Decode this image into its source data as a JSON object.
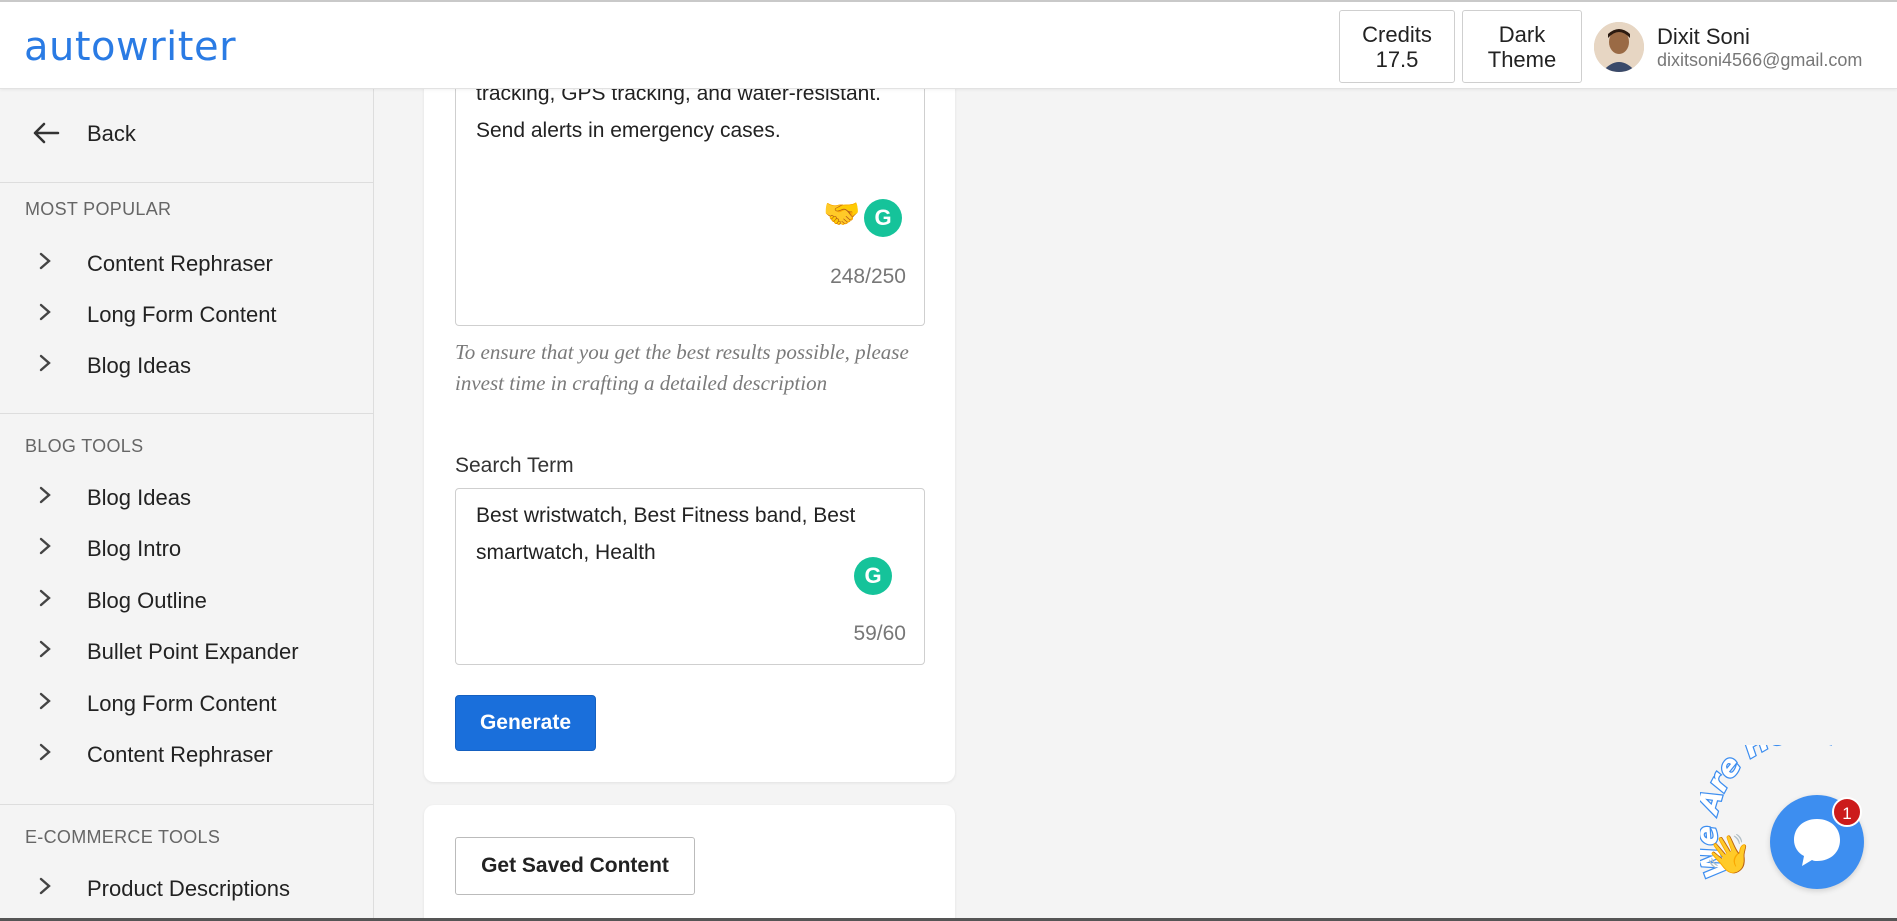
{
  "brand": {
    "logo": "autowriter",
    "accent": "#2a7be4"
  },
  "header": {
    "credits_label": "Credits",
    "credits_value": "17.5",
    "theme_line1": "Dark",
    "theme_line2": "Theme",
    "user_name": "Dixit Soni",
    "user_email": "dixitsoni4566@gmail.com"
  },
  "sidebar": {
    "back_label": "Back",
    "sections": [
      {
        "title": "MOST POPULAR",
        "items": [
          "Content Rephraser",
          "Long Form Content",
          "Blog Ideas"
        ]
      },
      {
        "title": "BLOG TOOLS",
        "items": [
          "Blog Ideas",
          "Blog Intro",
          "Blog Outline",
          "Bullet Point Expander",
          "Long Form Content",
          "Content Rephraser"
        ]
      },
      {
        "title": "E-COMMERCE TOOLS",
        "items": [
          "Product Descriptions"
        ]
      }
    ]
  },
  "form": {
    "description_text_line1": "tracking, GPS tracking, and water-resistant.",
    "description_text_line2": "Send alerts in emergency cases.",
    "description_counter": "248/250",
    "hint": "To ensure that you get the best results possible, please invest time in crafting a detailed description",
    "search_term_label": "Search Term",
    "search_term_line1": "Best wristwatch, Best Fitness band, Best",
    "search_term_line2": "smartwatch, Health",
    "search_term_counter": "59/60",
    "generate_label": "Generate",
    "grammarly_glyph": "G",
    "handshake_glyph": "🤝"
  },
  "saved": {
    "button_label": "Get Saved Content"
  },
  "chat": {
    "banner": "We Are Here!",
    "unread_count": "1",
    "wave_glyph": "👋",
    "accent": "#3d8ef0"
  }
}
